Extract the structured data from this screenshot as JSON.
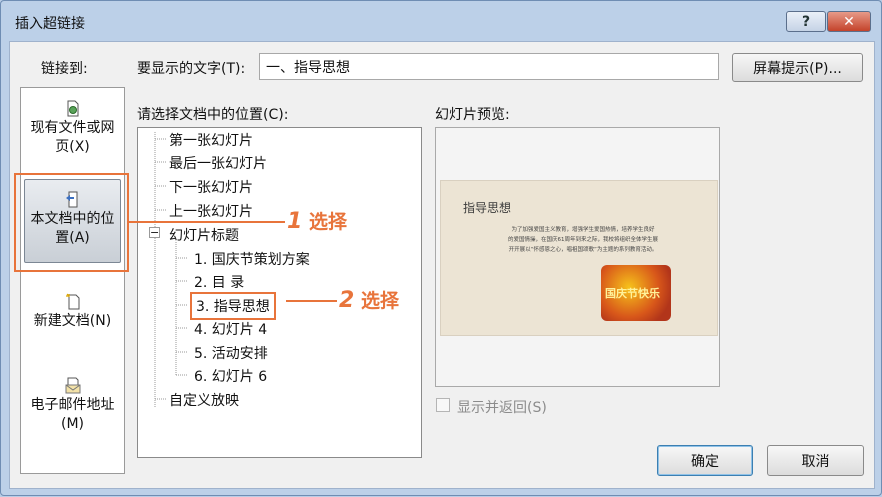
{
  "window": {
    "title": "插入超链接",
    "help_label": "?",
    "close_label": "✕"
  },
  "link_to": {
    "label": "链接到:",
    "items": [
      {
        "line1": "现有文件或网",
        "line2": "页(X)",
        "icon": "globe-file-icon"
      },
      {
        "line1": "本文档中的位",
        "line2": "置(A)",
        "icon": "document-place-icon",
        "selected": true
      },
      {
        "line1": "新建文档(N)",
        "line2": "",
        "icon": "new-document-icon"
      },
      {
        "line1": "电子邮件地址",
        "line2": "(M)",
        "icon": "email-icon"
      }
    ]
  },
  "display_text": {
    "label": "要显示的文字(T):",
    "value": "一、指导思想"
  },
  "screentip_button": "屏幕提示(P)...",
  "tree": {
    "label": "请选择文档中的位置(C):",
    "first": "第一张幻灯片",
    "last": "最后一张幻灯片",
    "next": "下一张幻灯片",
    "prev": "上一张幻灯片",
    "titles_group": "幻灯片标题",
    "titles": [
      "1. 国庆节策划方案",
      "2. 目  录",
      "3. 指导思想",
      "4. 幻灯片 4",
      "5. 活动安排",
      "6. 幻灯片 6"
    ],
    "custom": "自定义放映",
    "expander": "−"
  },
  "preview": {
    "label": "幻灯片预览:",
    "slide_title": "指导思想",
    "slide_body_line1": "为了加强爱国主义教育，增强学生爱国热情，培养学生良好",
    "slide_body_line2": "的爱国情操，在国庆61周年到来之际，我校将组织全体学生展",
    "slide_body_line3": "开开展以“怀感恩之心，唱祖国颂歌”为主题的系列教育活动。",
    "slide_image_text": "国庆节快乐"
  },
  "show_and_return": "显示并返回(S)",
  "ok_button": "确定",
  "cancel_button": "取消",
  "annotations": {
    "step1_num": "1",
    "step1_text": "选择",
    "step2_num": "2",
    "step2_text": "选择"
  },
  "colors": {
    "annotation": "#e8743b",
    "titlebar": "#bcd0e8"
  }
}
